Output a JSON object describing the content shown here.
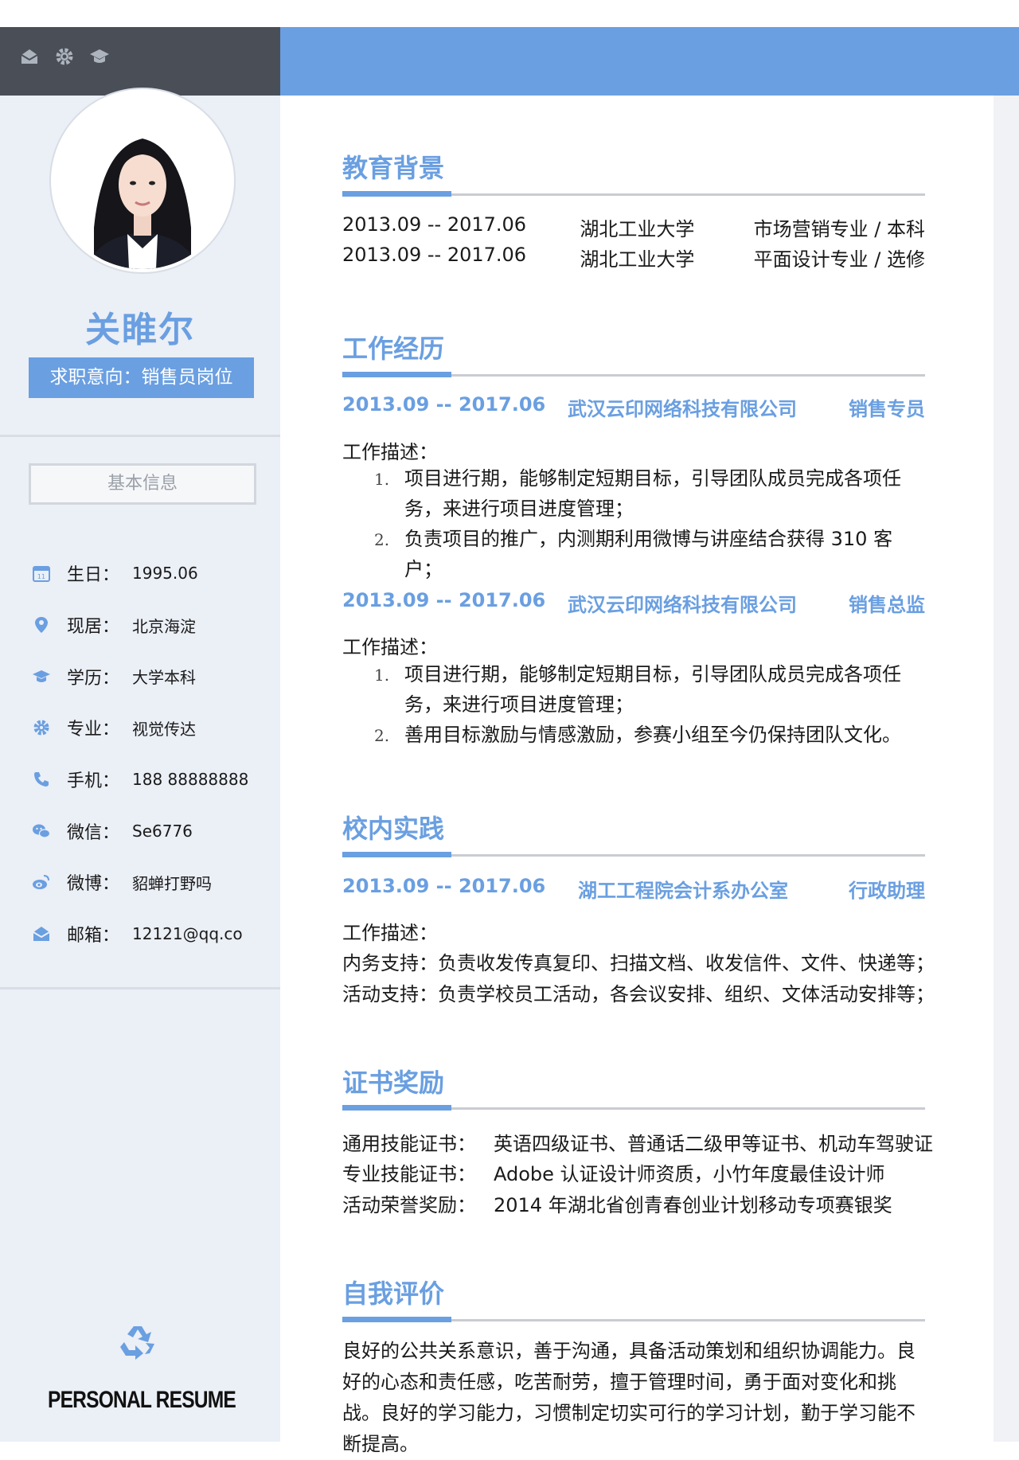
{
  "profile": {
    "name": "关睢尔",
    "intent": "求职意向：销售员岗位",
    "basic_info_title": "基本信息",
    "info": [
      {
        "icon": "calendar-icon",
        "label": "生日：",
        "value": "1995.06"
      },
      {
        "icon": "location-icon",
        "label": "现居：",
        "value": "北京海淀"
      },
      {
        "icon": "graduation-cap-icon",
        "label": "学历：",
        "value": "大学本科"
      },
      {
        "icon": "gear-icon",
        "label": "专业：",
        "value": "视觉传达"
      },
      {
        "icon": "phone-icon",
        "label": "手机：",
        "value": "188 88888888"
      },
      {
        "icon": "wechat-icon",
        "label": "微信：",
        "value": "Se6776"
      },
      {
        "icon": "weibo-icon",
        "label": "微博：",
        "value": "貂蝉打野吗"
      },
      {
        "icon": "mail-icon",
        "label": "邮箱：",
        "value": "12121@qq.co"
      }
    ],
    "footer": "PERSONAL RESUME"
  },
  "colors": {
    "accent": "#6a9fe1",
    "dark": "#4a4f57",
    "sidebar": "#ebeff6"
  },
  "education": {
    "title": "教育背景",
    "rows": [
      {
        "date": "2013.09 -- 2017.06",
        "school": "湖北工业大学",
        "major": "市场营销专业 / 本科"
      },
      {
        "date": "2013.09 -- 2017.06",
        "school": "湖北工业大学",
        "major": "平面设计专业 / 选修"
      }
    ]
  },
  "work": {
    "title": "工作经历",
    "jobs": [
      {
        "date": "2013.09 -- 2017.06",
        "company": "武汉云印网络科技有限公司",
        "role": "销售专员",
        "desc_label": "工作描述：",
        "items": [
          "项目进行期，能够制定短期目标，引导团队成员完成各项任务，来进行项目进度管理；",
          "负责项目的推广，内测期利用微博与讲座结合获得 310 客户；"
        ]
      },
      {
        "date": "2013.09 -- 2017.06",
        "company": "武汉云印网络科技有限公司",
        "role": "销售总监",
        "desc_label": "工作描述：",
        "items": [
          "项目进行期，能够制定短期目标，引导团队成员完成各项任务，来进行项目进度管理；",
          "善用目标激励与情感激励，参赛小组至今仍保持团队文化。"
        ]
      }
    ]
  },
  "campus": {
    "title": "校内实践",
    "date": "2013.09 -- 2017.06",
    "org": "湖工工程院会计系办公室",
    "role": "行政助理",
    "desc_label": "工作描述：",
    "lines": [
      "内务支持：负责收发传真复印、扫描文档、收发信件、文件、快递等；",
      "活动支持：负责学校员工活动，各会议安排、组织、文体活动安排等；"
    ]
  },
  "certs": {
    "title": "证书奖励",
    "rows": [
      {
        "label": "通用技能证书：",
        "value": "英语四级证书、普通话二级甲等证书、机动车驾驶证"
      },
      {
        "label": "专业技能证书：",
        "value": "Adobe 认证设计师资质，小竹年度最佳设计师"
      },
      {
        "label": "活动荣誉奖励：",
        "value": "2014 年湖北省创青春创业计划移动专项赛银奖"
      }
    ]
  },
  "self": {
    "title": "自我评价",
    "text": "良好的公共关系意识，善于沟通，具备活动策划和组织协调能力。良好的心态和责任感，吃苦耐劳，擅于管理时间，勇于面对变化和挑战。良好的学习能力，习惯制定切实可行的学习计划，勤于学习能不断提高。"
  }
}
